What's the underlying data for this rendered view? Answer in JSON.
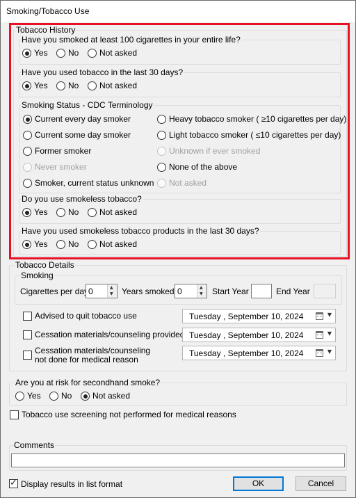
{
  "window": {
    "title": "Smoking/Tobacco Use"
  },
  "tobacco_history": {
    "title": "Tobacco History",
    "q100": {
      "question": "Have you smoked at least 100 cigarettes in your entire life?",
      "options": [
        "Yes",
        "No",
        "Not asked"
      ],
      "selected": "Yes"
    },
    "q30": {
      "question": "Have you used tobacco in the last 30 days?",
      "options": [
        "Yes",
        "No",
        "Not asked"
      ],
      "selected": "Yes"
    },
    "status": {
      "title": "Smoking Status - CDC Terminology",
      "options": [
        "Current every day smoker",
        "Current some day smoker",
        "Former smoker",
        "Never smoker",
        "Smoker, current status unknown",
        "Heavy tobacco smoker ( ≥10 cigarettes per day)",
        "Light tobacco smoker ( ≤10 cigarettes per day)",
        "Unknown if ever smoked",
        "None of the above",
        "Not asked"
      ],
      "selected": "Current every day smoker"
    },
    "smokeless": {
      "question": "Do you use smokeless tobacco?",
      "options": [
        "Yes",
        "No",
        "Not asked"
      ],
      "selected": "Yes"
    },
    "smokeless30": {
      "question": "Have you used smokeless tobacco products in the last 30 days?",
      "options": [
        "Yes",
        "No",
        "Not asked"
      ],
      "selected": "Yes"
    }
  },
  "tobacco_details": {
    "title": "Tobacco Details",
    "smoking": {
      "title": "Smoking",
      "cigarettes_label": "Cigarettes per day",
      "cigarettes_value": "0",
      "years_label": "Years smoked",
      "years_value": "0",
      "start_year_label": "Start Year",
      "start_year_value": "",
      "end_year_label": "End Year",
      "end_year_value": ""
    },
    "rows": [
      {
        "label": "Advised to quit tobacco use",
        "checked": false,
        "day": "Tuesday",
        "date": ", September 10, 2024"
      },
      {
        "label": "Cessation materials/counseling provided",
        "checked": false,
        "day": "Tuesday",
        "date": ", September 10, 2024"
      },
      {
        "label": "Cessation materials/counseling",
        "label2": "not done for medical reason",
        "checked": false,
        "day": "Tuesday",
        "date": ", September 10, 2024"
      }
    ]
  },
  "secondhand": {
    "question": "Are you at risk for secondhand smoke?",
    "options": [
      "Yes",
      "No",
      "Not asked"
    ],
    "selected": "Not asked"
  },
  "screening": {
    "label": "Tobacco use screening not performed for medical reasons",
    "checked": false
  },
  "comments": {
    "title": "Comments",
    "value": ""
  },
  "footer": {
    "display_list_label": "Display results in list format",
    "display_list_checked": true,
    "ok_label": "OK",
    "cancel_label": "Cancel"
  },
  "colors": {
    "highlight": "#e81123",
    "accent": "#0078d7",
    "background": "#f0f0f0"
  }
}
